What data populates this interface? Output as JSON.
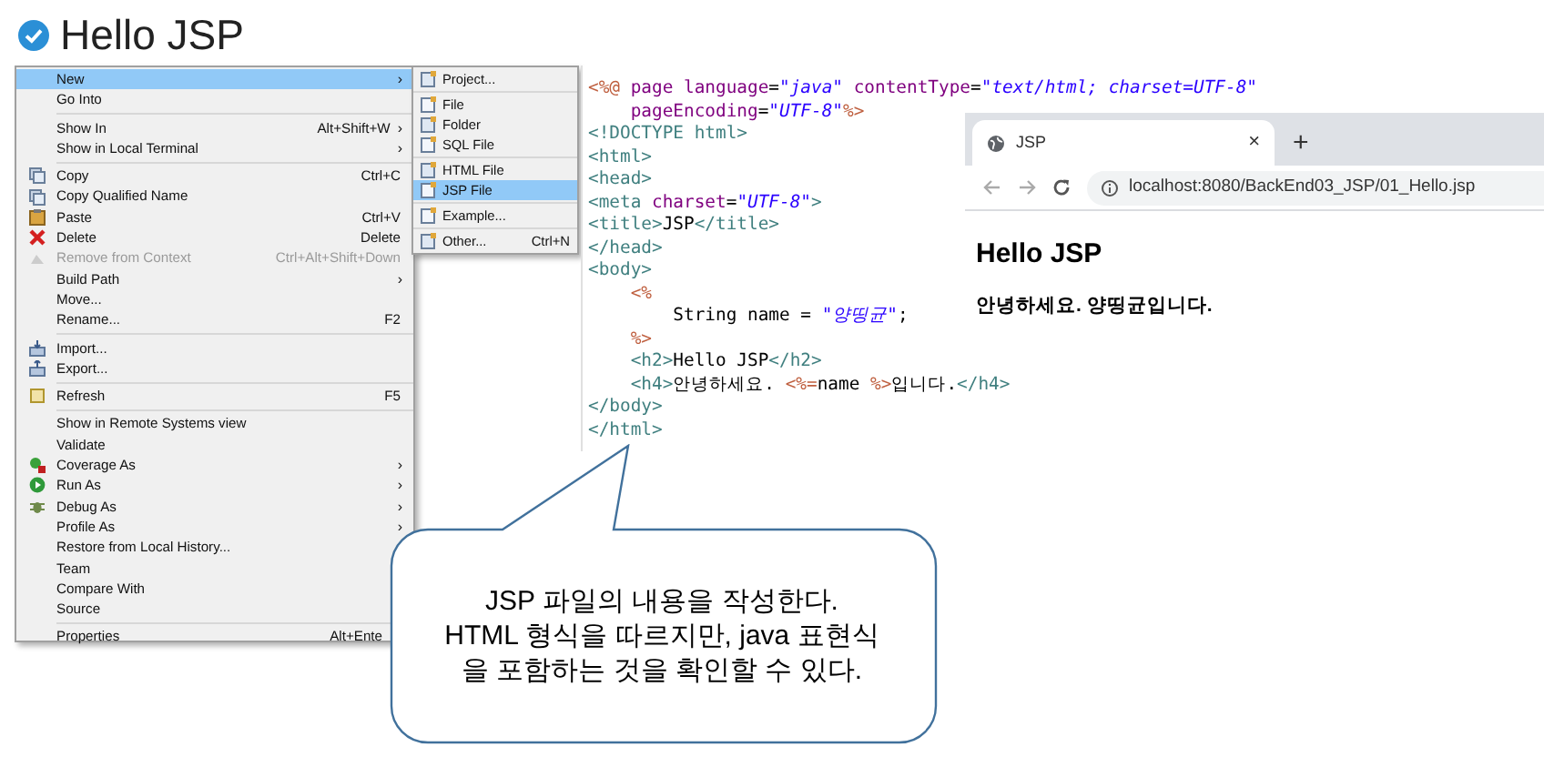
{
  "title": "Hello JSP",
  "context_menu": {
    "groups": [
      [
        {
          "label": "New",
          "arrow": "›",
          "disabled": false,
          "selected": true
        },
        {
          "label": "Go Into",
          "disabled": false,
          "selected": false
        }
      ],
      [
        {
          "label": "Show In",
          "shortcut": "Alt+Shift+W",
          "arrow": "›",
          "disabled": false,
          "selected": false
        },
        {
          "label": "Show in Local Terminal",
          "arrow": "›",
          "disabled": false,
          "selected": false
        }
      ],
      [
        {
          "label": "Copy",
          "shortcut": "Ctrl+C",
          "disabled": false,
          "selected": false
        },
        {
          "label": "Copy Qualified Name",
          "disabled": false,
          "selected": false
        },
        {
          "label": "Paste",
          "shortcut": "Ctrl+V",
          "disabled": false,
          "selected": false
        },
        {
          "label": "Delete",
          "shortcut": "Delete",
          "disabled": false,
          "selected": false
        },
        {
          "label": "Remove from Context",
          "shortcut": "Ctrl+Alt+Shift+Down",
          "disabled": true,
          "selected": false
        },
        {
          "label": "Build Path",
          "arrow": "›",
          "disabled": false,
          "selected": false
        },
        {
          "label": "Move...",
          "disabled": false,
          "selected": false
        },
        {
          "label": "Rename...",
          "shortcut": "F2",
          "disabled": false,
          "selected": false
        }
      ],
      [
        {
          "label": "Import...",
          "disabled": false,
          "selected": false
        },
        {
          "label": "Export...",
          "disabled": false,
          "selected": false
        }
      ],
      [
        {
          "label": "Refresh",
          "shortcut": "F5",
          "disabled": false,
          "selected": false
        }
      ],
      [
        {
          "label": "Show in Remote Systems view",
          "disabled": false,
          "selected": false
        },
        {
          "label": "Validate",
          "disabled": false,
          "selected": false
        },
        {
          "label": "Coverage As",
          "arrow": "›",
          "disabled": false,
          "selected": false
        },
        {
          "label": "Run As",
          "arrow": "›",
          "disabled": false,
          "selected": false
        },
        {
          "label": "Debug As",
          "arrow": "›",
          "disabled": false,
          "selected": false
        },
        {
          "label": "Profile As",
          "arrow": "›",
          "disabled": false,
          "selected": false
        },
        {
          "label": "Restore from Local History...",
          "disabled": false,
          "selected": false
        },
        {
          "label": "Team",
          "disabled": false,
          "selected": false
        },
        {
          "label": "Compare With",
          "disabled": false,
          "selected": false
        },
        {
          "label": "Source",
          "disabled": false,
          "selected": false
        }
      ],
      [
        {
          "label": "Properties",
          "shortcut": "Alt+Ente",
          "disabled": false,
          "selected": false
        }
      ]
    ]
  },
  "submenu": {
    "groups": [
      [
        {
          "label": "Project...",
          "selected": false
        }
      ],
      [
        {
          "label": "File",
          "selected": false
        },
        {
          "label": "Folder",
          "selected": false
        },
        {
          "label": "SQL File",
          "selected": false
        }
      ],
      [
        {
          "label": "HTML File",
          "selected": false
        },
        {
          "label": "JSP File",
          "selected": true
        }
      ],
      [
        {
          "label": "Example...",
          "selected": false
        }
      ],
      [
        {
          "label": "Other...",
          "shortcut": "Ctrl+N",
          "selected": false
        }
      ]
    ]
  },
  "code": {
    "lines": [
      [
        {
          "kind": "directive",
          "text": "<%@"
        },
        {
          "kind": "attr",
          "text": " page"
        },
        {
          "kind": "attr",
          "text": " language"
        },
        {
          "kind": "text",
          "text": "="
        },
        {
          "kind": "value",
          "text": "\"java\""
        },
        {
          "kind": "attr",
          "text": " contentType"
        },
        {
          "kind": "text",
          "text": "="
        },
        {
          "kind": "value",
          "text": "\"text/html; charset=UTF-8\""
        }
      ],
      [
        {
          "kind": "attr",
          "text": "    pageEncoding"
        },
        {
          "kind": "text",
          "text": "="
        },
        {
          "kind": "value",
          "text": "\"UTF-8\""
        },
        {
          "kind": "directive",
          "text": "%>"
        }
      ],
      [
        {
          "kind": "tag",
          "text": "<!DOCTYPE html>"
        }
      ],
      [
        {
          "kind": "tag",
          "text": "<html>"
        }
      ],
      [
        {
          "kind": "tag",
          "text": "<head>"
        }
      ],
      [
        {
          "kind": "tag",
          "text": "<meta"
        },
        {
          "kind": "attr",
          "text": " charset"
        },
        {
          "kind": "text",
          "text": "="
        },
        {
          "kind": "value",
          "text": "\"UTF-8\""
        },
        {
          "kind": "tag",
          "text": ">"
        }
      ],
      [
        {
          "kind": "tag",
          "text": "<title>"
        },
        {
          "kind": "text",
          "text": "JSP"
        },
        {
          "kind": "tag",
          "text": "</title>"
        }
      ],
      [
        {
          "kind": "tag",
          "text": "</head>"
        }
      ],
      [
        {
          "kind": "tag",
          "text": "<body>"
        }
      ],
      [
        {
          "kind": "directive",
          "text": "    <%"
        }
      ],
      [
        {
          "kind": "text",
          "text": "        String name = "
        },
        {
          "kind": "value",
          "text": "\"양띵균\""
        },
        {
          "kind": "text",
          "text": ";"
        }
      ],
      [
        {
          "kind": "directive",
          "text": "    %>"
        }
      ],
      [
        {
          "kind": "tag",
          "text": "    <h2>"
        },
        {
          "kind": "text",
          "text": "Hello JSP"
        },
        {
          "kind": "tag",
          "text": "</h2>"
        }
      ],
      [
        {
          "kind": "tag",
          "text": "    <h4>"
        },
        {
          "kind": "text",
          "text": "안녕하세요. "
        },
        {
          "kind": "directive",
          "text": "<%="
        },
        {
          "kind": "text",
          "text": "name "
        },
        {
          "kind": "directive",
          "text": "%>"
        },
        {
          "kind": "text",
          "text": "입니다."
        },
        {
          "kind": "tag",
          "text": "</h4>"
        }
      ],
      [
        {
          "kind": "tag",
          "text": "</body>"
        }
      ],
      [
        {
          "kind": "tag",
          "text": "</html>"
        }
      ]
    ]
  },
  "browser": {
    "tab": {
      "title": "JSP",
      "close": "×"
    },
    "new_tab": "+",
    "url": "localhost:8080/BackEnd03_JSP/01_Hello.jsp",
    "heading": "Hello JSP",
    "text": "안녕하세요. 양띵균입니다."
  },
  "callout": {
    "lines": [
      "JSP 파일의 내용을 작성한다.",
      "HTML 형식을 따르지만, java 표현식",
      "을 포함하는 것을 확인할 수 있다."
    ]
  }
}
